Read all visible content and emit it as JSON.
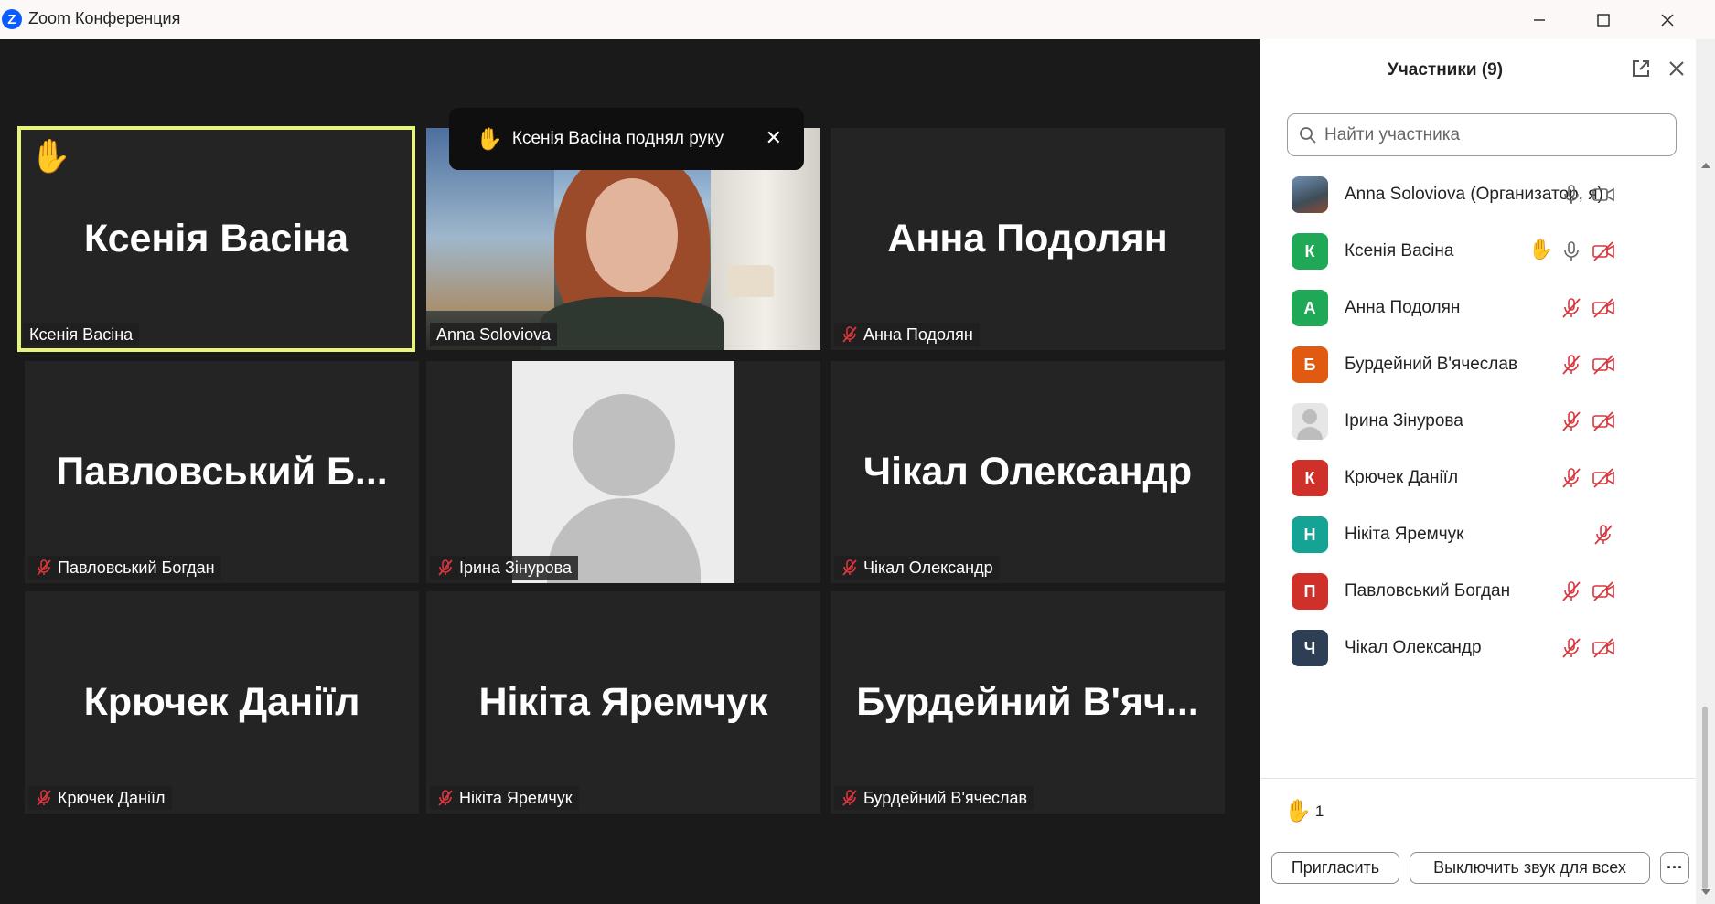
{
  "window": {
    "title": "Zoom Конференция",
    "logo_letter": "Z",
    "accent": "#0b5cff"
  },
  "toast": {
    "text": "Ксенія Васіна поднял руку",
    "hand": "✋",
    "close": "✕"
  },
  "tiles": [
    {
      "big_name": "Ксенія Васіна",
      "label": "Ксенія Васіна",
      "muted": false,
      "active": true,
      "hand": "✋",
      "kind": "name"
    },
    {
      "big_name": "",
      "label": "Anna Soloviova",
      "muted": false,
      "active": false,
      "kind": "video"
    },
    {
      "big_name": "Анна Подолян",
      "label": "Анна Подолян",
      "muted": true,
      "active": false,
      "kind": "name"
    },
    {
      "big_name": "Павловський  Б...",
      "label": "Павловський Богдан",
      "muted": true,
      "active": false,
      "kind": "name"
    },
    {
      "big_name": "",
      "label": "Ірина Зінурова",
      "muted": true,
      "active": false,
      "kind": "avatar"
    },
    {
      "big_name": "Чікал Олександр",
      "label": "Чікал Олександр",
      "muted": true,
      "active": false,
      "kind": "name"
    },
    {
      "big_name": "Крючек Даніїл",
      "label": "Крючек Даніїл",
      "muted": true,
      "active": false,
      "kind": "name"
    },
    {
      "big_name": "Нікіта Яремчук",
      "label": "Нікіта Яремчук",
      "muted": true,
      "active": false,
      "kind": "name"
    },
    {
      "big_name": "Бурдейний  В'яч...",
      "label": "Бурдейний В'ячеслав",
      "muted": true,
      "active": false,
      "kind": "name"
    }
  ],
  "panel": {
    "title": "Участники (9)",
    "search_placeholder": "Найти участника",
    "participants": [
      {
        "initial": "",
        "name": "Anna Soloviova (Организатор, я)",
        "color": "#4b6a8a",
        "photo": true,
        "hand": false,
        "mic": "on",
        "video": "on"
      },
      {
        "initial": "К",
        "name": "Ксенія Васіна",
        "color": "#1fa855",
        "hand": true,
        "mic": "on",
        "video": "off"
      },
      {
        "initial": "А",
        "name": "Анна Подолян",
        "color": "#1fa855",
        "hand": false,
        "mic": "off",
        "video": "off"
      },
      {
        "initial": "Б",
        "name": "Бурдейний В'ячеслав",
        "color": "#e05a12",
        "hand": false,
        "mic": "off",
        "video": "off"
      },
      {
        "initial": "",
        "name": "Ірина Зінурова",
        "color": "#e6e6e6",
        "default_avatar": true,
        "hand": false,
        "mic": "off",
        "video": "off"
      },
      {
        "initial": "К",
        "name": "Крючек Даніїл",
        "color": "#d0302a",
        "hand": false,
        "mic": "off",
        "video": "off"
      },
      {
        "initial": "Н",
        "name": "Нікіта Яремчук",
        "color": "#14a394",
        "hand": false,
        "mic": "off",
        "video": "none"
      },
      {
        "initial": "П",
        "name": "Павловський Богдан",
        "color": "#d0302a",
        "hand": false,
        "mic": "off",
        "video": "off"
      },
      {
        "initial": "Ч",
        "name": "Чікал Олександр",
        "color": "#2d3e55",
        "hand": false,
        "mic": "off",
        "video": "off"
      }
    ],
    "raised_hands_count": "1",
    "invite_label": "Пригласить",
    "mute_all_label": "Выключить звук для всех",
    "more_label": "···"
  },
  "colors": {
    "muted_red": "#d9363e",
    "active_tile_border": "#e8f47a"
  }
}
